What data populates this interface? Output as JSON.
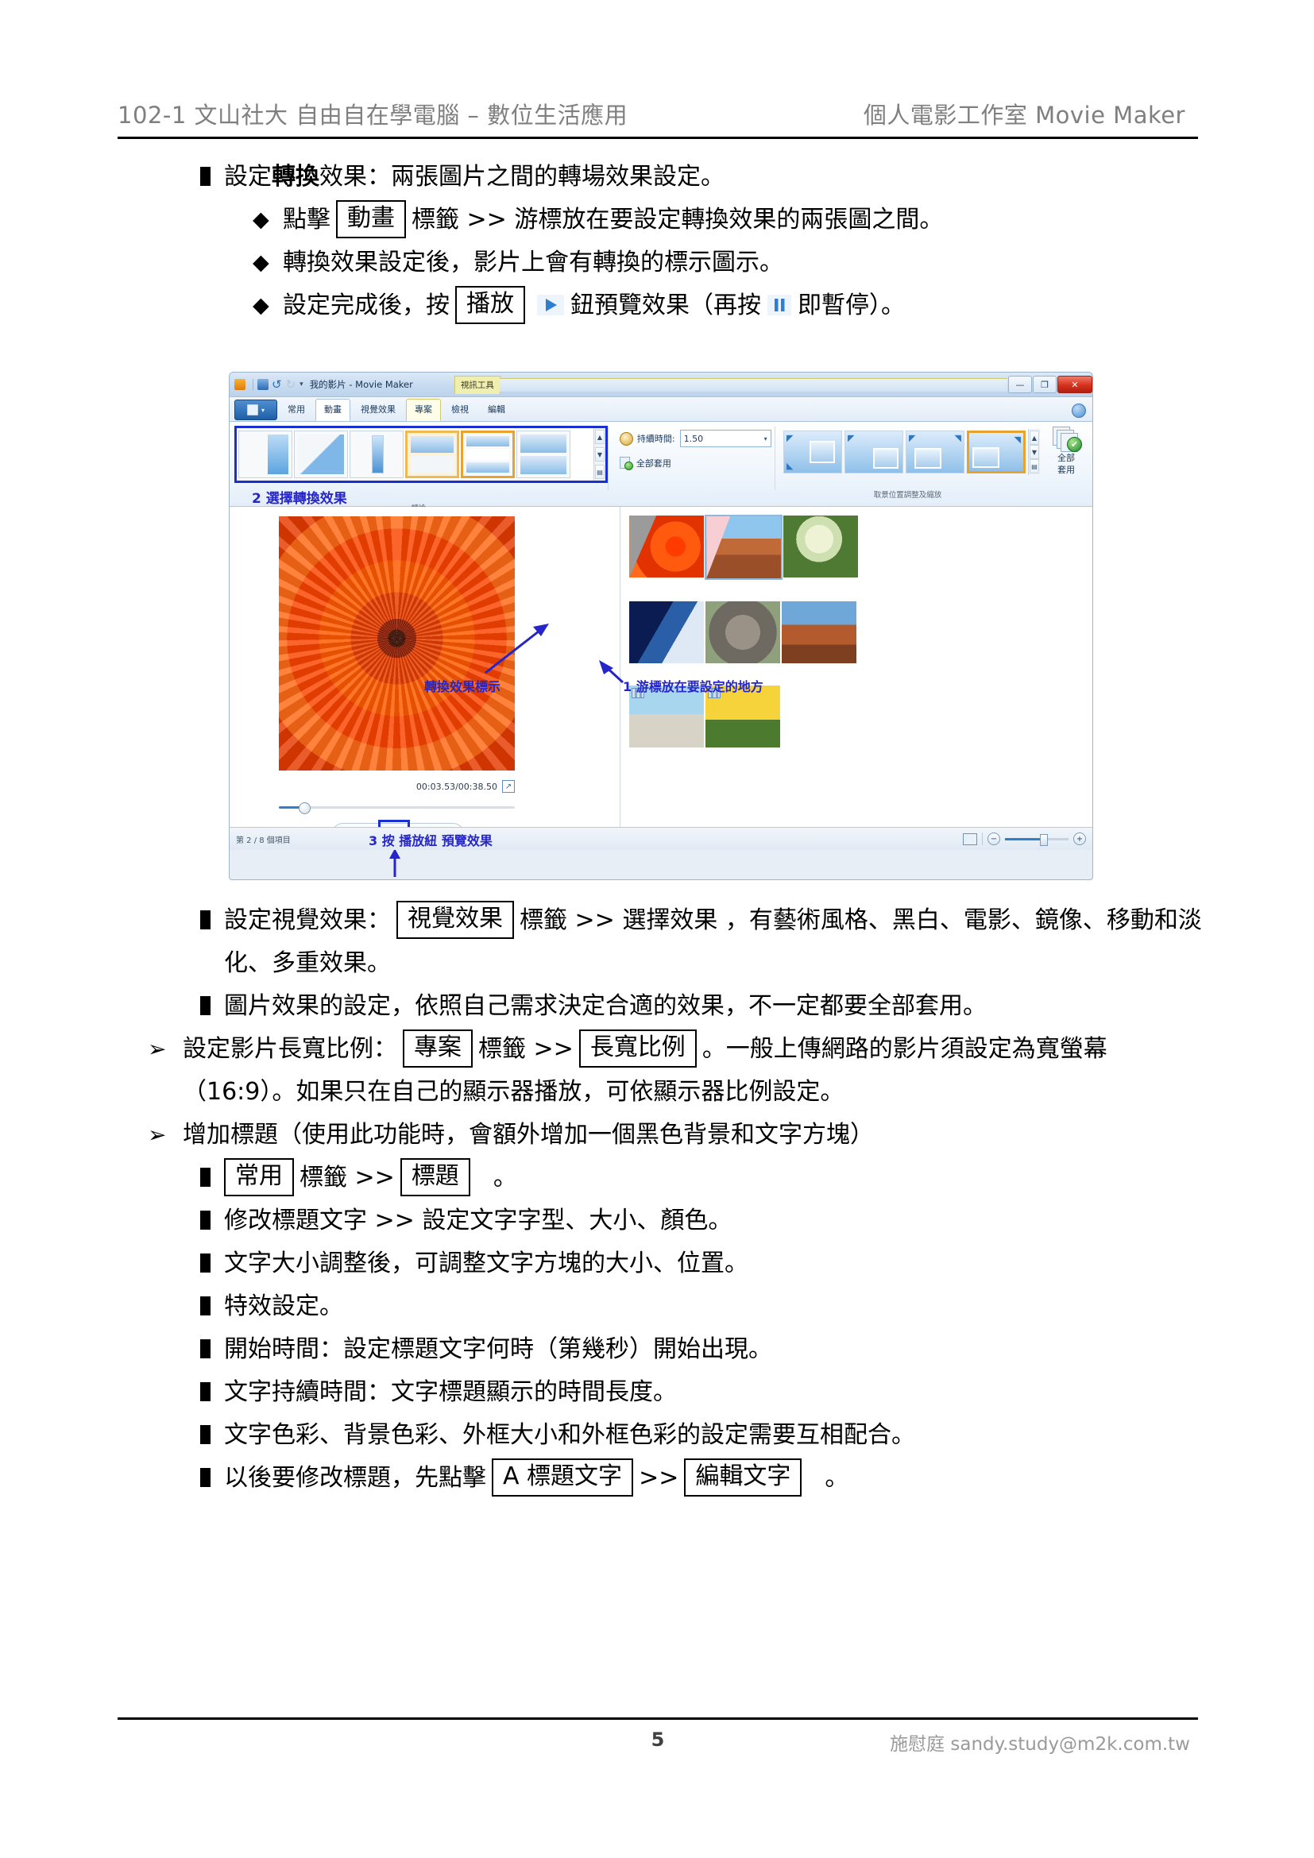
{
  "header": {
    "left": "102-1 文山社大 自由自在學電腦 – 數位生活應用",
    "right": "個人電影工作室 Movie Maker"
  },
  "body": {
    "b1_pre": "設定",
    "b1_bold": "轉換",
    "b1_post": "效果：兩張圖片之間的轉場效果設定。",
    "d1_pre": "點擊",
    "d1_box": "動畫",
    "d1_post": "標籤 >> 游標放在要設定轉換效果的兩張圖之間。",
    "d2": "轉換效果設定後，影片上會有轉換的標示圖示。",
    "d3_pre": "設定完成後，按",
    "d3_box": "播放",
    "d3_mid": "鈕預覽效果（再按",
    "d3_post": "即暫停）。",
    "b2_pre": "設定視覺效果：",
    "b2_box": "視覺效果",
    "b2_post": "標籤 >> 選擇效果 ，有藝術風格、黑白、電影、鏡像、移動和淡化、多重效果。",
    "b3": "圖片效果的設定，依照自己需求決定合適的效果，不一定都要全部套用。",
    "a1_pre": "設定影片長寬比例：",
    "a1_box1": "專案",
    "a1_mid": "標籤 >>",
    "a1_box2": "長寬比例",
    "a1_post": "。一般上傳網路的影片須設定為寬螢幕（16:9）。如果只在自己的顯示器播放，可依顯示器比例設定。",
    "a2": "增加標題（使用此功能時，會額外增加一個黑色背景和文字方塊）",
    "c1_box1": "常用",
    "c1_mid": "標籤 >>",
    "c1_box2": "標題",
    "c1_post": "。",
    "c2": "修改標題文字 >> 設定文字字型、大小、顏色。",
    "c3": "文字大小調整後，可調整文字方塊的大小、位置。",
    "c4": "特效設定。",
    "c5": "開始時間：設定標題文字何時（第幾秒）開始出現。",
    "c6": "文字持續時間：文字標題顯示的時間長度。",
    "c7": "文字色彩、背景色彩、外框大小和外框色彩的設定需要互相配合。",
    "c8_pre": "以後要修改標題，先點擊",
    "c8_box1": "A 標題文字",
    "c8_mid": ">>",
    "c8_box2": "編輯文字",
    "c8_post": "。"
  },
  "screenshot": {
    "title": "我的影片 - Movie Maker",
    "context_tab": "視訊工具",
    "tabs": [
      {
        "label": "常用",
        "state": "normal"
      },
      {
        "label": "動畫",
        "state": "selected"
      },
      {
        "label": "視覺效果",
        "state": "normal"
      },
      {
        "label": "專案",
        "state": "contextual"
      },
      {
        "label": "檢視",
        "state": "normal"
      },
      {
        "label": "編輯",
        "state": "normal"
      }
    ],
    "window_buttons": {
      "minimize": "—",
      "maximize": "❐",
      "close": "✕"
    },
    "ribbon": {
      "duration_label": "持續時間:",
      "duration_value": "1.50",
      "apply_all_small": "全部套用",
      "group_transitions": "轉換",
      "group_pan_zoom": "取景位置調整及縮放",
      "apply_all_big": "全部\n套用",
      "apply_all_big_line1": "全部",
      "apply_all_big_line2": "套用"
    },
    "annotations": {
      "a2": "2 選擇轉換效果",
      "trans_marker": "轉換效果標示",
      "a1": "1 游標放在要設定的地方",
      "a3": "3 按 播放紐 預覽效果"
    },
    "preview": {
      "time": "00:03.53/00:38.50"
    },
    "status": {
      "items": "第 2 / 8 個項目"
    }
  },
  "footer": {
    "page": "5",
    "author": "施慰庭 sandy.study@m2k.com.tw"
  }
}
